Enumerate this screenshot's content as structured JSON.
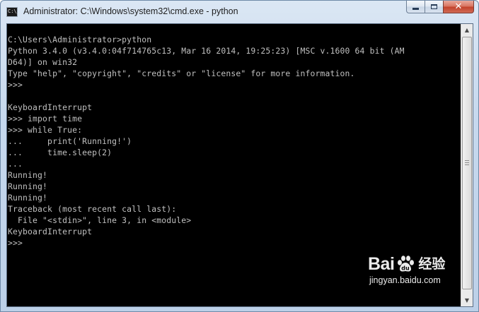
{
  "window": {
    "title": "Administrator: C:\\Windows\\system32\\cmd.exe - python",
    "app_icon_text": "C:\\_"
  },
  "caption_buttons": {
    "minimize": "minimize",
    "maximize": "maximize",
    "close": "close"
  },
  "console": {
    "lines": [
      "C:\\Users\\Administrator>python",
      "Python 3.4.0 (v3.4.0:04f714765c13, Mar 16 2014, 19:25:23) [MSC v.1600 64 bit (AM",
      "D64)] on win32",
      "Type \"help\", \"copyright\", \"credits\" or \"license\" for more information.",
      ">>>",
      "",
      "KeyboardInterrupt",
      ">>> import time",
      ">>> while True:",
      "...     print('Running!')",
      "...     time.sleep(2)",
      "...",
      "Running!",
      "Running!",
      "Running!",
      "Traceback (most recent call last):",
      "  File \"<stdin>\", line 3, in <module>",
      "KeyboardInterrupt",
      ">>>"
    ]
  },
  "watermark": {
    "logo_left": "Bai",
    "logo_right": "经验",
    "url": "jingyan.baidu.com"
  },
  "colors": {
    "console_background": "#000000",
    "console_text": "#c0c0c0",
    "close_button": "#c2412a"
  }
}
